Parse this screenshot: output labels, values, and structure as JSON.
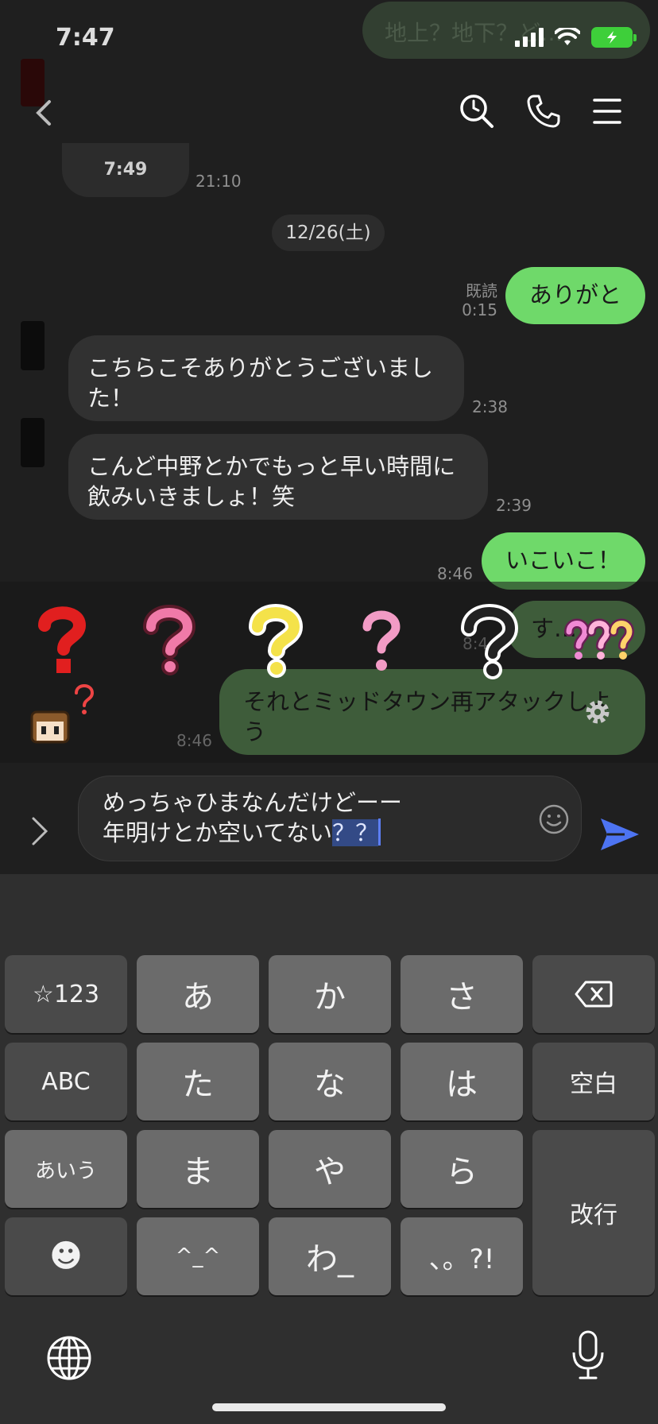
{
  "status": {
    "time": "7:47"
  },
  "chat": {
    "top_ghost_text": "地上？地下？ど…",
    "voice_card_label": "7:49",
    "voice_card_time": "21:10",
    "date_separator": "12/26(土)",
    "messages": [
      {
        "side": "out",
        "text": "ありがと",
        "read_label": "既読",
        "time": "0:15"
      },
      {
        "side": "in",
        "text": "こちらこそありがとうございました！",
        "time": "2:38"
      },
      {
        "side": "in",
        "text": "こんど中野とかでもっと早い時間に飲みいきましょ！笑",
        "time": "2:39"
      },
      {
        "side": "out",
        "text": "いこいこ！",
        "time": "8:46"
      },
      {
        "side": "out",
        "text": "す…",
        "time": "8:4…"
      },
      {
        "side": "out",
        "text": "それとミッドタウン再アタックしよう",
        "time": "8:46"
      }
    ]
  },
  "stickers": [
    "red-question-mark",
    "pink-question-mark",
    "yellow-question-mark",
    "pink-thin-question-mark",
    "outline-question-mark",
    "triple-question-marks",
    "character-with-question"
  ],
  "composer": {
    "line1": "めっちゃひまなんだけどーー",
    "line2_plain": "年明けとか空いてない",
    "line2_selected": "？？"
  },
  "keyboard": {
    "rows": [
      [
        "☆123",
        "あ",
        "か",
        "さ",
        "⌫"
      ],
      [
        "ABC",
        "た",
        "な",
        "は",
        "空白"
      ],
      [
        "あいう",
        "ま",
        "や",
        "ら",
        "改行"
      ],
      [
        "☻",
        "^_^",
        "わ_",
        "、。?!"
      ]
    ]
  },
  "colors": {
    "out_bubble": "#6fd96a",
    "in_bubble": "#313131",
    "send_accent": "#4d74f2",
    "battery": "#3ecf3a"
  }
}
